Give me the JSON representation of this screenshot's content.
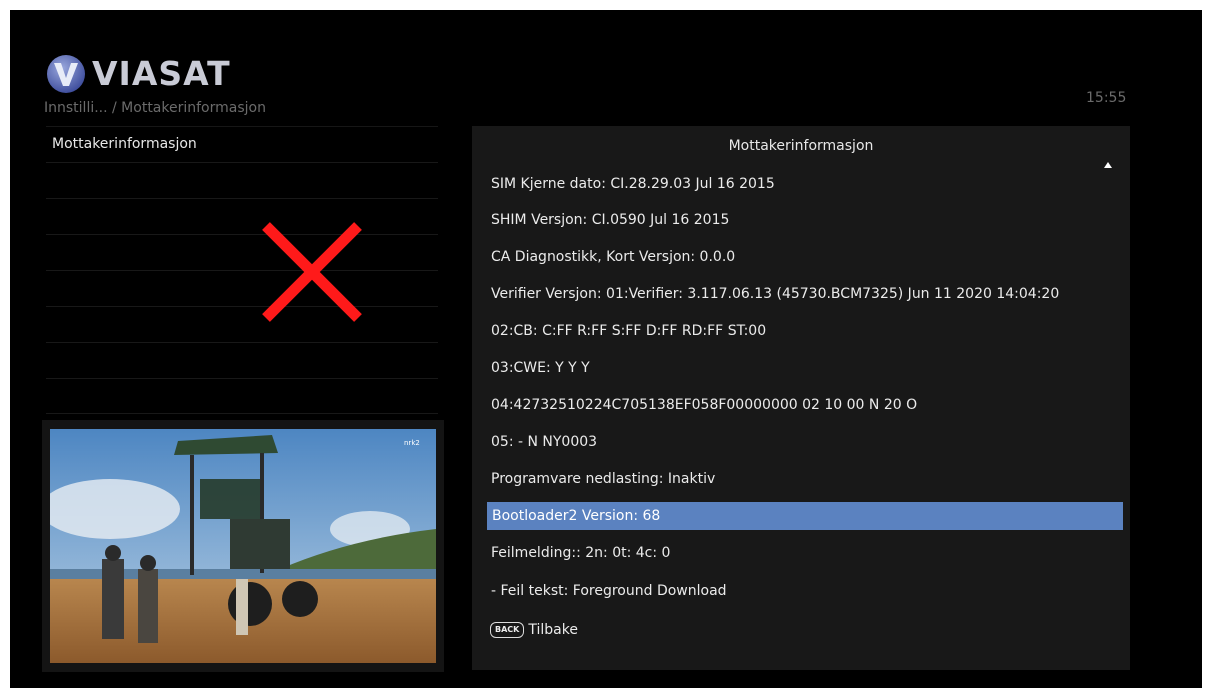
{
  "header": {
    "brand": "VIASAT",
    "logo_icon": "viasat-v-logo",
    "breadcrumb": "Innstilli...  / Mottakerinformasjon",
    "clock": "15:55"
  },
  "left_menu": {
    "items": [
      {
        "label": "Mottakerinformasjon"
      }
    ],
    "overlay_icon": "red-x-mark-icon",
    "overlay_color": "#ff1a1a"
  },
  "preview": {
    "channel_badge": "nrk2"
  },
  "panel": {
    "title": "Mottakerinformasjon",
    "scroll_icon": "scroll-up-arrow-icon",
    "rows": [
      {
        "text": "SIM Kjerne dato: CI.28.29.03 Jul 16 2015"
      },
      {
        "text": "SHIM Versjon: CI.0590 Jul 16 2015"
      },
      {
        "text": "CA Diagnostikk, Kort Versjon: 0.0.0"
      },
      {
        "text": "Verifier Versjon:  01:Verifier: 3.117.06.13 (45730.BCM7325) Jun 11 2020 14:04:20"
      },
      {
        "text": "02:CB: C:FF R:FF S:FF D:FF RD:FF ST:00"
      },
      {
        "text": "03:CWE: Y Y Y"
      },
      {
        "text": "04:42732510224C705138EF058F00000000 02 10 00 N 20 O"
      },
      {
        "text": "05: - N NY0003"
      },
      {
        "text": "Programvare nedlasting: Inaktiv"
      },
      {
        "text": "Bootloader2 Version: 68"
      },
      {
        "text": "Feilmelding:: 2n:  0t:  4c:  0"
      },
      {
        "text": "- Feil tekst: Foreground Download"
      }
    ],
    "selected_index": 9,
    "selected_color": "#5b82c0",
    "back_key": "BACK",
    "back_label": "Tilbake"
  }
}
